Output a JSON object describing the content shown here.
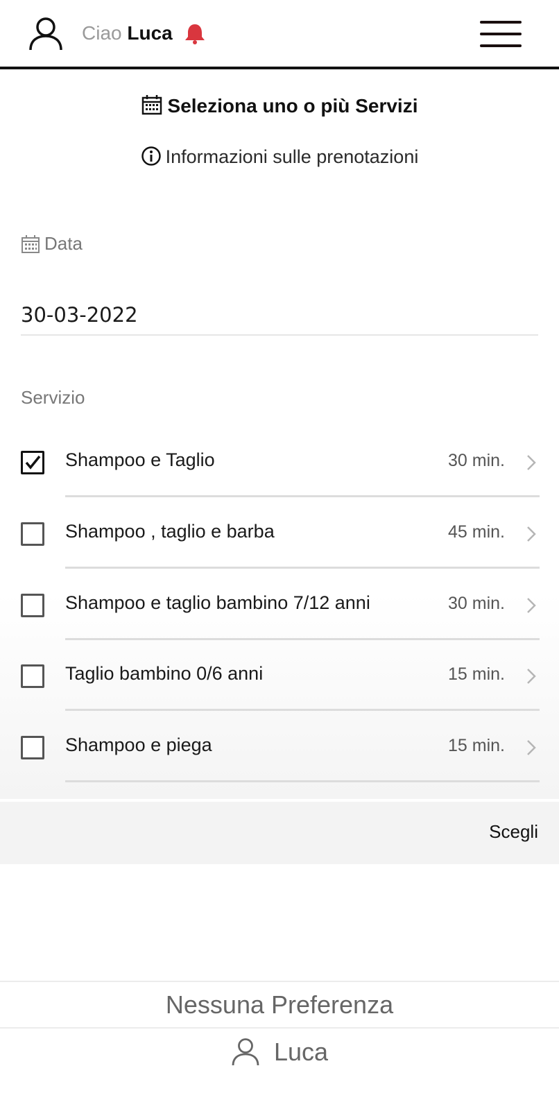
{
  "header": {
    "greeting_prefix": "Ciao",
    "user_name": "Luca",
    "bell_color": "#d9363e",
    "icons": {
      "user": "user-icon",
      "bell": "bell-icon",
      "menu": "hamburger-menu-icon"
    }
  },
  "page": {
    "title": "Seleziona uno o più Servizi",
    "info_link": "Informazioni sulle prenotazioni"
  },
  "date_field": {
    "label": "Data",
    "value": "30-03-2022"
  },
  "services": {
    "label": "Servizio",
    "items": [
      {
        "name": "Shampoo e Taglio",
        "duration": "30 min.",
        "checked": true
      },
      {
        "name": "Shampoo , taglio e barba",
        "duration": "45 min.",
        "checked": false
      },
      {
        "name": "Shampoo e taglio bambino 7/12 anni",
        "duration": "30 min.",
        "checked": false
      },
      {
        "name": "Taglio bambino 0/6 anni",
        "duration": "15 min.",
        "checked": false
      },
      {
        "name": "Shampoo e piega",
        "duration": "15 min.",
        "checked": false
      }
    ]
  },
  "actions": {
    "choose_label": "Scegli"
  },
  "operators": {
    "no_preference": "Nessuna Preferenza",
    "luca": "Luca"
  }
}
